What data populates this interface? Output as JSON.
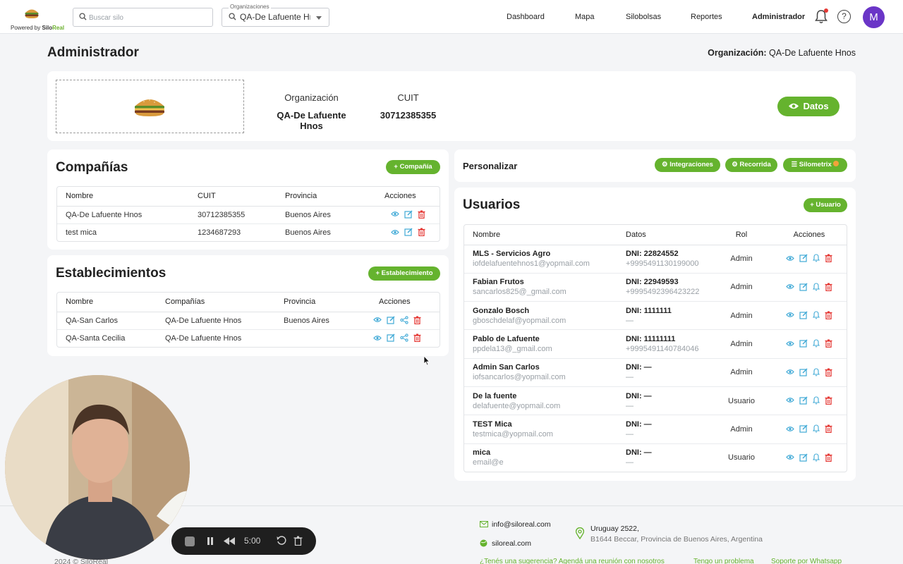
{
  "header": {
    "powered_prefix": "Powered by ",
    "powered_brand_a": "Silo",
    "powered_brand_b": "Real",
    "search_placeholder": "Buscar silo",
    "org_select_label": "Organizaciones",
    "org_select_value": "QA-De Lafuente Hnos",
    "nav": [
      "Dashboard",
      "Mapa",
      "Silobolsas",
      "Reportes",
      "Administrador"
    ],
    "active_nav": "Administrador",
    "help_glyph": "?",
    "avatar_initial": "M"
  },
  "page": {
    "title": "Administrador",
    "org_label_key": "Organización:",
    "org_label_value": "QA-De Lafuente Hnos"
  },
  "top_card": {
    "org_header": "Organización",
    "org_value": "QA-De Lafuente Hnos",
    "cuit_header": "CUIT",
    "cuit_value": "30712385355",
    "datos_button": "Datos"
  },
  "companias": {
    "title": "Compañías",
    "add_button": "Compañía",
    "columns": [
      "Nombre",
      "CUIT",
      "Provincia",
      "Acciones"
    ],
    "rows": [
      {
        "nombre": "QA-De Lafuente Hnos",
        "cuit": "30712385355",
        "provincia": "Buenos Aires"
      },
      {
        "nombre": "test mica",
        "cuit": "1234687293",
        "provincia": "Buenos Aires"
      }
    ]
  },
  "establecimientos": {
    "title": "Establecimientos",
    "add_button": "Establecimiento",
    "columns": [
      "Nombre",
      "Compañías",
      "Provincia",
      "Acciones"
    ],
    "rows": [
      {
        "nombre": "QA-San Carlos",
        "compania": "QA-De Lafuente Hnos",
        "provincia": "Buenos Aires"
      },
      {
        "nombre": "QA-Santa Cecilia",
        "compania": "QA-De Lafuente Hnos",
        "provincia": ""
      }
    ]
  },
  "personalizar": {
    "title": "Personalizar",
    "buttons": [
      "Integraciones",
      "Recorrida",
      "Silometrix"
    ]
  },
  "usuarios": {
    "title": "Usuarios",
    "add_button": "Usuario",
    "columns": [
      "Nombre",
      "Datos",
      "Rol",
      "Acciones"
    ],
    "rows": [
      {
        "nombre": "MLS - Servicios Agro",
        "email": "iofdelafuentehnos1@yopmail.com",
        "dni": "DNI: 22824552",
        "tel": "+9995491130199000",
        "rol": "Admin"
      },
      {
        "nombre": "Fabian Frutos",
        "email": "sancarlos825@_gmail.com",
        "dni": "DNI: 22949593",
        "tel": "+9995492396423222",
        "rol": "Admin"
      },
      {
        "nombre": "Gonzalo Bosch",
        "email": "gboschdelaf@yopmail.com",
        "dni": "DNI: 1111111",
        "tel": "—",
        "rol": "Admin"
      },
      {
        "nombre": "Pablo de Lafuente",
        "email": "ppdela13@_gmail.com",
        "dni": "DNI: 11111111",
        "tel": "+9995491140784046",
        "rol": "Admin"
      },
      {
        "nombre": "Admin San Carlos",
        "email": "iofsancarlos@yopmail.com",
        "dni": "DNI: —",
        "tel": "—",
        "rol": "Admin"
      },
      {
        "nombre": "De la fuente",
        "email": "delafuente@yopmail.com",
        "dni": "DNI: —",
        "tel": "—",
        "rol": "Usuario"
      },
      {
        "nombre": "TEST Mica",
        "email": "testmica@yopmail.com",
        "dni": "DNI: —",
        "tel": "—",
        "rol": "Admin"
      },
      {
        "nombre": "mica",
        "email": "email@e",
        "dni": "DNI: —",
        "tel": "—",
        "rol": "Usuario"
      }
    ]
  },
  "footer": {
    "email": "info@siloreal.com",
    "web": "siloreal.com",
    "address_line1": "Uruguay 2522,",
    "address_line2": "B1644 Beccar, Provincia de Buenos Aires, Argentina",
    "copyright": "2024 © SiloReal",
    "links": [
      "¿Tenés una sugerencia? Agendá una reunión con nosotros",
      "Tengo un problema",
      "Soporte por Whatsapp"
    ]
  },
  "recorder": {
    "time": "5:00"
  },
  "colors": {
    "brand_green": "#65b32e",
    "danger_red": "#e53935",
    "view_blue": "#3fa9d6",
    "avatar_purple": "#6a35c7"
  }
}
